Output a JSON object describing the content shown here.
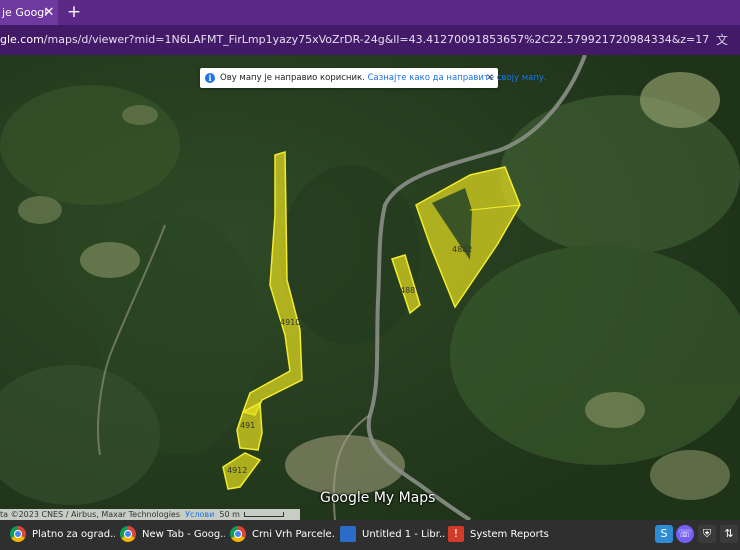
{
  "browser": {
    "tab_title": "je Googl",
    "tab_close": "✕",
    "new_tab": "+",
    "url_host": "gle.com",
    "url_rest": "/maps/d/viewer?mid=1N6LAFMT_FirLmp1yazy75xVoZrDR-24g&ll=43.41270091853657%2C22.579921720984334&z=17",
    "translate_icon": "translate-icon"
  },
  "map": {
    "notice_text": "Ову мапу је направио корисник.",
    "notice_link": "Сазнајте како да направите своју мапу.",
    "notice_close": "×",
    "parcels": [
      "4910",
      "491",
      "4912",
      "4887",
      "4882"
    ],
    "parcel_color": "#e8e020",
    "logo": "Google My Maps",
    "attribution": "ta ©2023 CNES / Airbus, Maxar Technologies",
    "terms": "Услови",
    "scale": "50 m"
  },
  "taskbar": {
    "items": [
      {
        "label": "Platno za ograd...",
        "icon": "chrome-icon"
      },
      {
        "label": "New Tab - Goog...",
        "icon": "chrome-icon"
      },
      {
        "label": "Crni Vrh Parcele...",
        "icon": "chrome-icon"
      },
      {
        "label": "Untitled 1 - Libr...",
        "icon": "writer-icon"
      },
      {
        "label": "System Reports",
        "icon": "report-icon"
      }
    ],
    "tray": [
      "skype-icon",
      "viber-icon",
      "shield-icon",
      "network-icon"
    ]
  }
}
